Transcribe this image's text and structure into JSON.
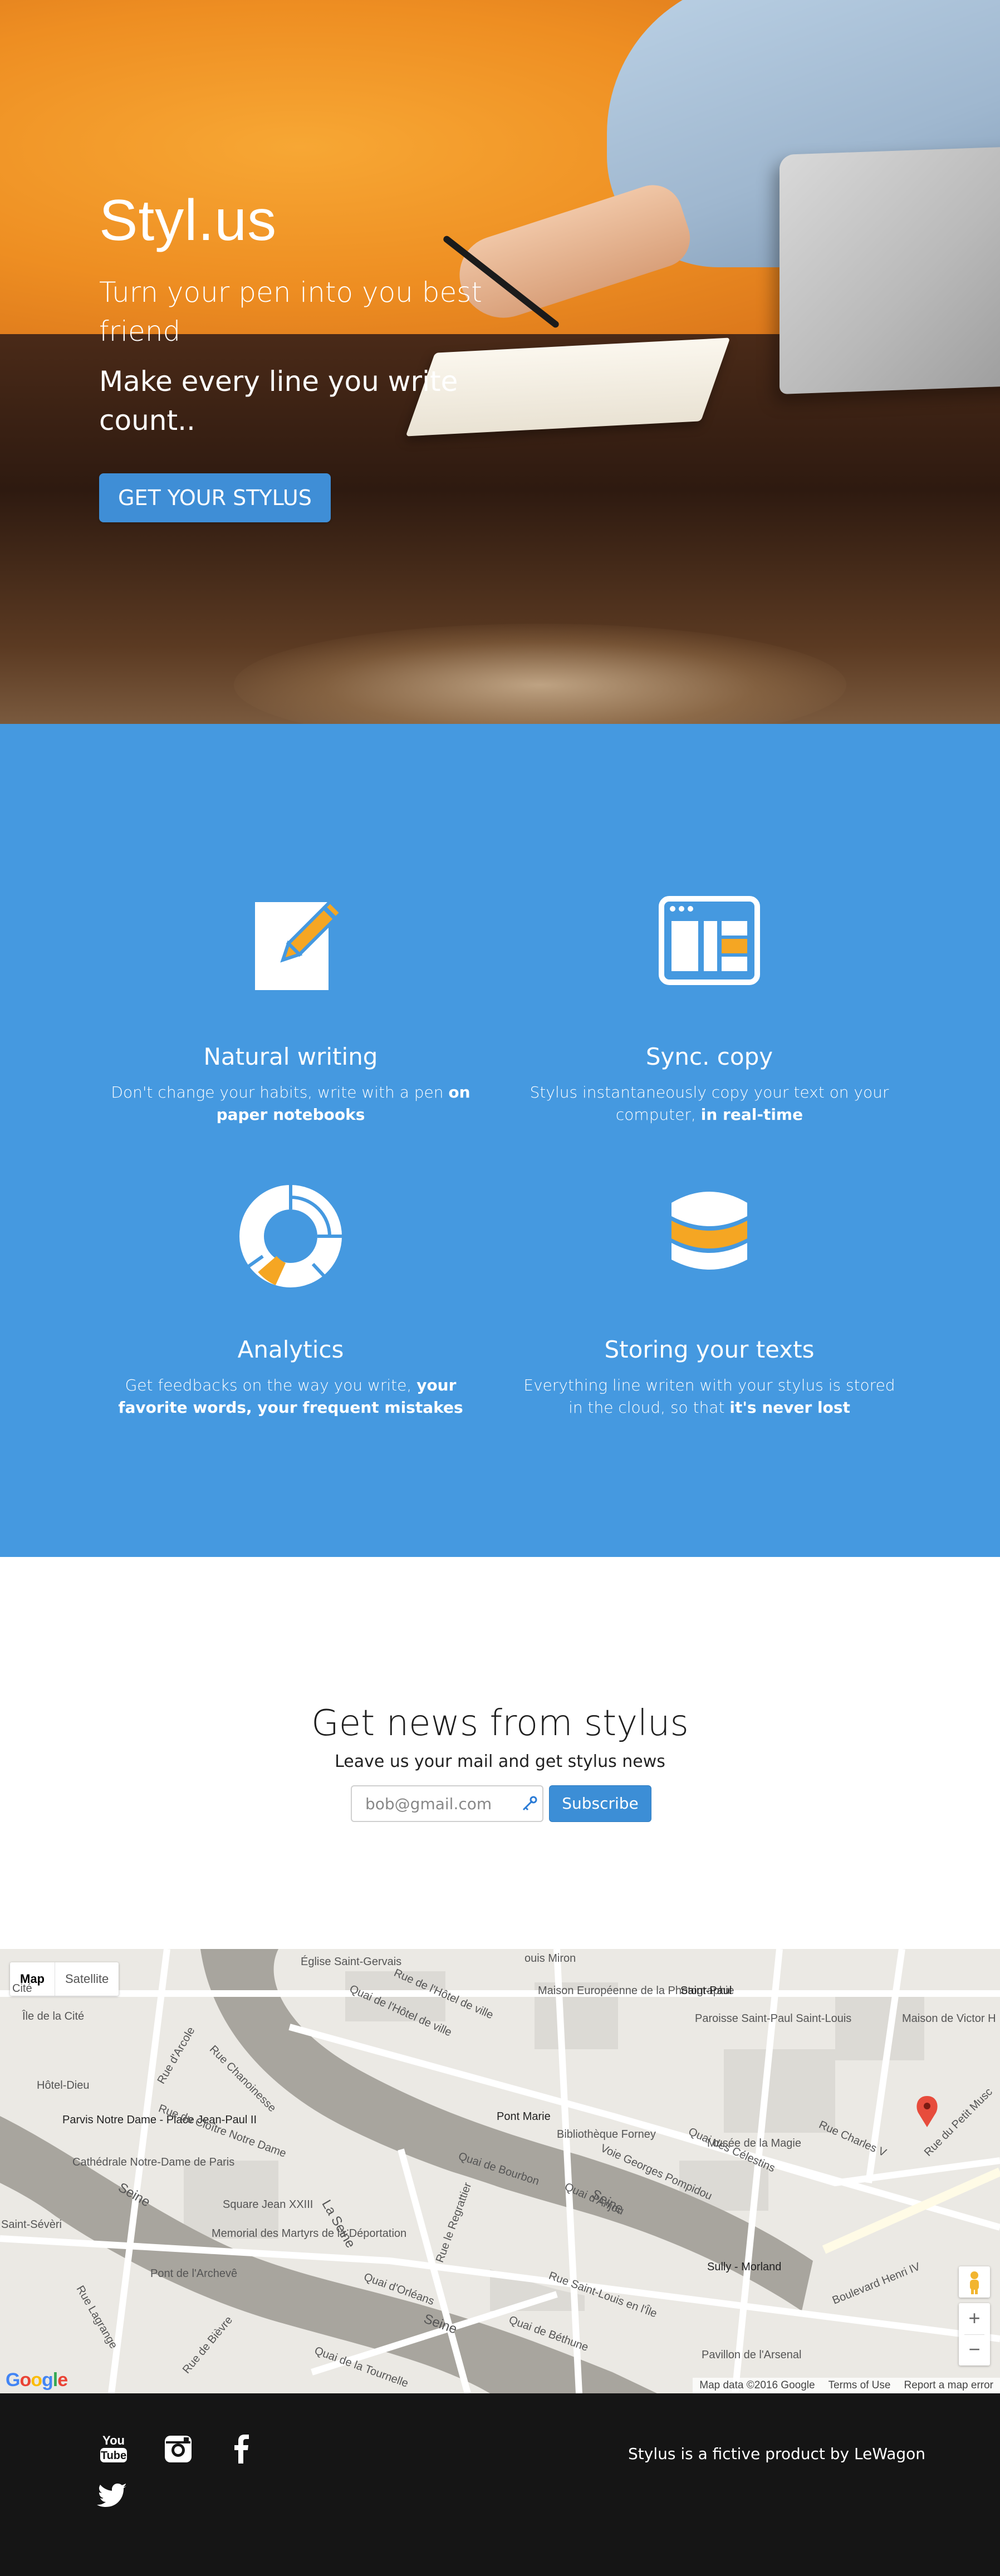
{
  "hero": {
    "title": "Styl.us",
    "subtitle": "Turn your pen into you best friend",
    "subtitle2": "Make every line you write count..",
    "cta_label": "GET YOUR STYLUS"
  },
  "features": [
    {
      "title": "Natural writing",
      "desc_plain": "Don't change your habits, write with a pen ",
      "desc_bold": "on paper notebooks",
      "icon": "pen-paper-icon"
    },
    {
      "title": "Sync. copy",
      "desc_plain": "Stylus instantaneously copy your text on your computer, ",
      "desc_bold": "in real-time",
      "icon": "browser-window-icon"
    },
    {
      "title": "Analytics",
      "desc_plain": "Get feedbacks on the way you write, ",
      "desc_bold": "your favorite words, your frequent mistakes",
      "icon": "donut-chart-icon"
    },
    {
      "title": "Storing your texts",
      "desc_plain": "Everything line writen with your stylus is stored in the cloud, so that ",
      "desc_bold": "it's never lost",
      "icon": "database-icon"
    }
  ],
  "newsletter": {
    "title": "Get news from stylus",
    "subtitle": "Leave us your mail and get stylus news",
    "email_placeholder": "bob@gmail.com",
    "subscribe_label": "Subscribe"
  },
  "map": {
    "type_map": "Map",
    "type_satellite": "Satellite",
    "labels": {
      "eglise": "Église Saint-Gervais",
      "quai_hotel": "Quai de l'Hôtel de ville",
      "rue_hotel": "Rue de l'Hôtel de ville",
      "louis_miron": "ouis Miron",
      "maison_photo": "Maison Européenne de la Photographie",
      "saint_paul": "Saint-Paul",
      "paroisse": "Paroisse Saint-Paul Saint-Louis",
      "maison_victor": "Maison de Victor H",
      "bibliotheque": "Bibliothèque Forney",
      "hotel_dieu": "Hôtel-Dieu",
      "ile_cite": "Île de la Cité",
      "parvis": "Parvis Notre Dame - Place Jean-Paul II",
      "cathedrale": "Cathédrale Notre-Dame de Paris",
      "cloitre": "Rue du Cloître Notre Dame",
      "chanoinesse": "Rue Chanoinesse",
      "arcole": "Rue d'Arcole",
      "pont_marie": "Pont Marie",
      "bourbon": "Quai de Bourbon",
      "regrattier": "Rue le Regrattier",
      "celestins": "Quai des Célestins",
      "pompidou": "Voie Georges Pompidou",
      "anjou": "Quai d'Anjou",
      "musee_magie": "Musée de la Magie",
      "charles_v": "Rue Charles V",
      "petit_musc": "Rue du Petit Musc",
      "sully": "Sully - Morland",
      "henri_iv": "Boulevard Henri IV",
      "seine1": "Seine",
      "seine2": "Seine",
      "seine3": "Seine",
      "la_seine": "La Seine",
      "saint_louis": "Rue Saint-Louis en l'Île",
      "orleans": "Quai d'Orléans",
      "bethune": "Quai de Béthune",
      "tournelle": "Quai de la Tournelle",
      "square": "Square Jean XXIII",
      "memorial": "Memorial des Martyrs de la Déportation",
      "pont_archeveche": "Pont de l'Archevê",
      "rue_bievre": "Rue de Bièvre",
      "lagrange": "Rue Lagrange",
      "saint_severin": "Saint-Sévèri",
      "arsenal": "Pavillon de l'Arsenal",
      "cite": "Cité"
    },
    "attribution": "Map data ©2016 Google",
    "terms": "Terms of Use",
    "report": "Report a map error",
    "logo": "Google"
  },
  "footer": {
    "credit": "Stylus is a fictive product by LeWagon",
    "icons": [
      "youtube-icon",
      "instagram-icon",
      "facebook-icon",
      "twitter-icon"
    ]
  },
  "colors": {
    "feature_bg": "#4599e0",
    "button_blue": "#3f8ed6",
    "accent_orange": "#f5a623",
    "footer_bg": "#151515"
  }
}
